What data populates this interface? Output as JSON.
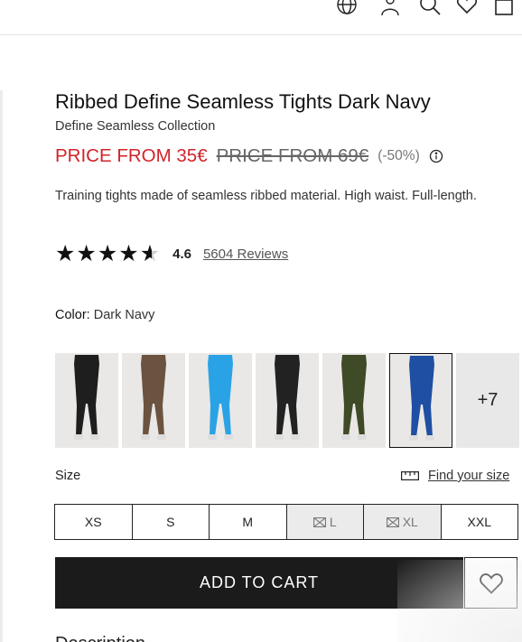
{
  "header": {
    "icons": [
      "globe-icon",
      "user-icon",
      "search-icon",
      "heart-icon",
      "bag-icon"
    ]
  },
  "product": {
    "title": "Ribbed Define Seamless Tights Dark Navy",
    "collection": "Define Seamless Collection",
    "price_now": "PRICE FROM 35€",
    "price_was": "PRICE FROM 69€",
    "discount": "(-50%)",
    "description": "Training tights made of seamless ribbed material. High waist. Full-length.",
    "rating_value": "4.6",
    "rating_stars": 4.6,
    "reviews_label": "5604 Reviews",
    "color_label": "Color:",
    "color_value": "Dark Navy"
  },
  "swatches": [
    {
      "name": "black",
      "color": "#1e1e1e"
    },
    {
      "name": "brown",
      "color": "#6b5340"
    },
    {
      "name": "sky-blue",
      "color": "#2aa3e6"
    },
    {
      "name": "black-2",
      "color": "#222222"
    },
    {
      "name": "olive",
      "color": "#3f4a26"
    },
    {
      "name": "dark-navy",
      "color": "#1f4fa3",
      "selected": true
    }
  ],
  "more_swatches": "+7",
  "size": {
    "label": "Size",
    "find_label": "Find your size",
    "options": [
      {
        "label": "XS",
        "available": true
      },
      {
        "label": "S",
        "available": true
      },
      {
        "label": "M",
        "available": true
      },
      {
        "label": "L",
        "available": false
      },
      {
        "label": "XL",
        "available": false
      },
      {
        "label": "XXL",
        "available": true
      }
    ]
  },
  "cart": {
    "add_label": "ADD TO CART"
  },
  "next_section": "Description"
}
